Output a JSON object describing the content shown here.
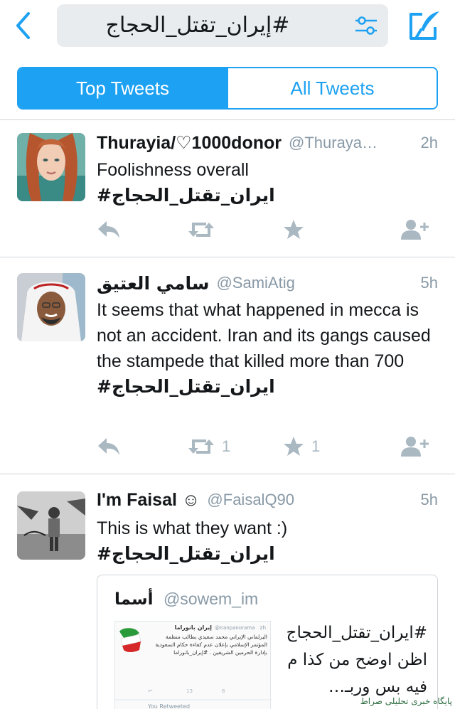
{
  "colors": {
    "accent": "#1da1f2",
    "action_gray": "#aab8c2",
    "handle_gray": "#8899a6",
    "search_bg": "#e9ecee"
  },
  "header": {
    "search_query": "#إيران_تقتل_الحجاج",
    "icons": {
      "back": "chevron-left-icon",
      "filter": "filter-sliders-icon",
      "compose": "compose-tweet-icon"
    }
  },
  "tabs": [
    {
      "label": "Top Tweets",
      "active": true
    },
    {
      "label": "All Tweets",
      "active": false
    }
  ],
  "tweets": [
    {
      "name": "Thurayia/♡1000donor",
      "handle": "@Thuraya…",
      "time": "2h",
      "text": "Foolishness overall",
      "hashtag": "#ايران_تقتل_الحجاج",
      "retweet_count": "",
      "like_count": ""
    },
    {
      "name": "سامي العتيق",
      "handle": "@SamiAtig",
      "time": "5h",
      "text": "It seems that what happened in mecca is not an accident. Iran and its gangs caused the stampede that killed more than 700",
      "hashtag": "#ايران_تقتل_الحجاج",
      "retweet_count": "1",
      "like_count": "1"
    },
    {
      "name": "I'm Faisal ☺",
      "handle": "@FaisalQ90",
      "time": "5h",
      "text": "This is what they want :)",
      "hashtag": "#ايران_تقتل_الحجاج"
    }
  ],
  "quote": {
    "name": "أسما",
    "handle": "@sowem_im",
    "text": "#ايران_تقتل_الحجاج اظن اوضح من كذا م فيه بس وربـ…",
    "thumb": {
      "name": "إيران بانوراما",
      "handle": "@Iranpanorama",
      "time": "2h",
      "body": "البرلماني الإيراني محمد سعيدي يطالب منظمة المؤتمر الإسلامي بإعلان عدم كفاءة حكام السعودية بإدارة الحرمين الشريفين . #إيران_بانوراما",
      "rt": "13",
      "likes": "8",
      "footer": "You Retweeted"
    }
  },
  "watermark": "پایگاه خبری تحلیلی صراط"
}
